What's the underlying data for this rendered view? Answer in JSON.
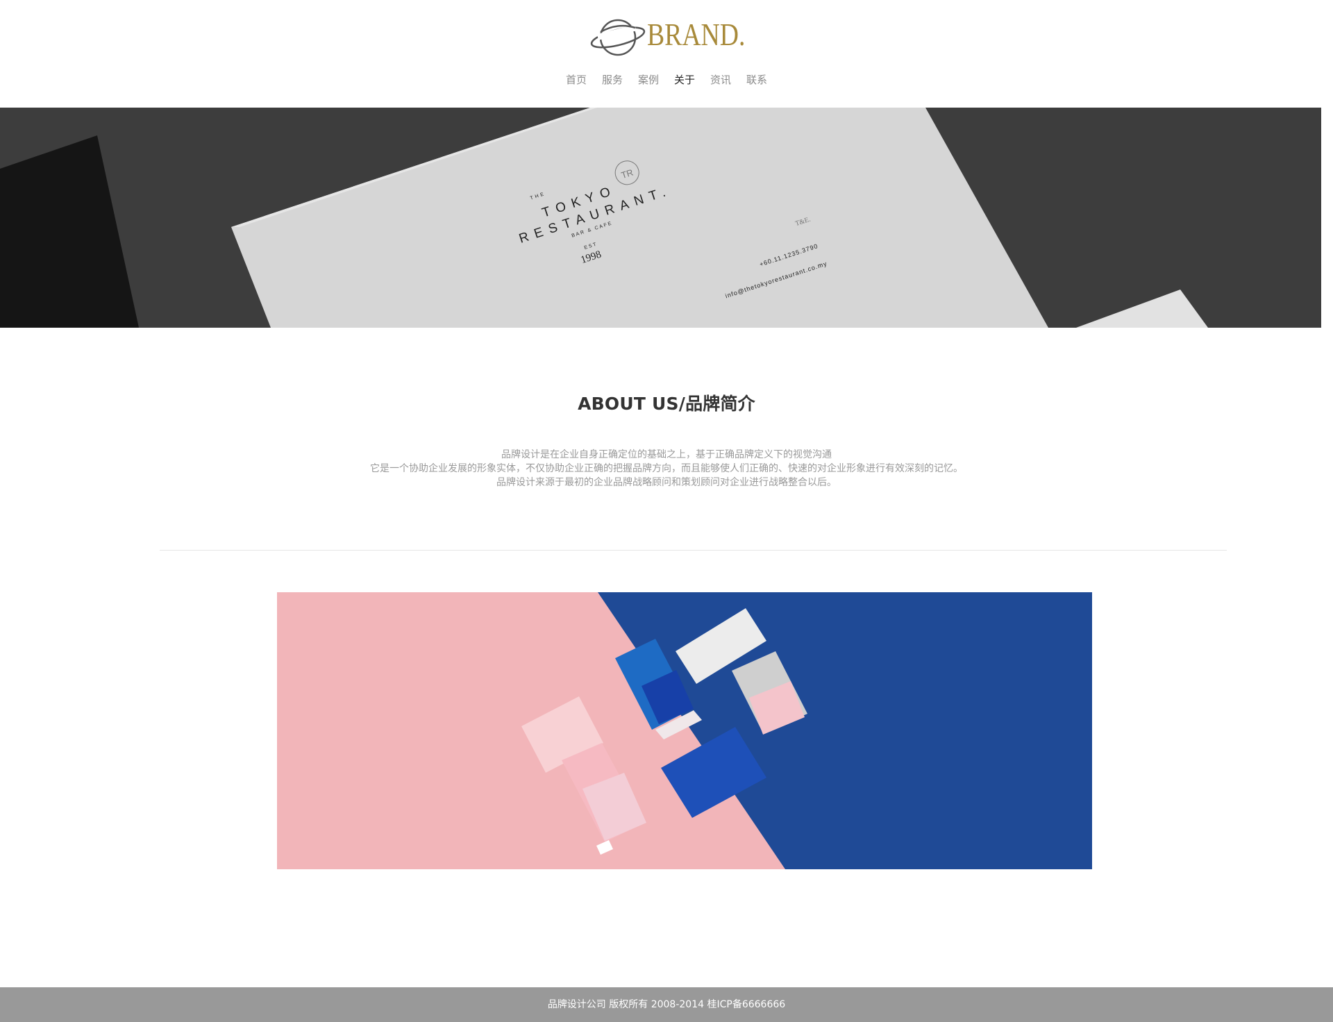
{
  "header": {
    "logo_text": "BRAND.",
    "nav": [
      {
        "label": "首页",
        "active": false
      },
      {
        "label": "服务",
        "active": false
      },
      {
        "label": "案例",
        "active": false
      },
      {
        "label": "关于",
        "active": true
      },
      {
        "label": "资讯",
        "active": false
      },
      {
        "label": "联系",
        "active": false
      }
    ]
  },
  "hero": {
    "card_the": "THE",
    "card_name1": "TOKYO",
    "card_name2": "RESTAURANT.",
    "card_tag": "BAR & CAFE",
    "card_est": "EST",
    "card_year": "1998",
    "card_monogram": "TR",
    "card_initials": "T&E.",
    "card_phone": "+60.11.1235.3790",
    "card_email": "info@thetokyorestaurant.co.my"
  },
  "about": {
    "title": "ABOUT US/品牌简介",
    "lines": [
      "品牌设计是在企业自身正确定位的基础之上，基于正确品牌定义下的视觉沟通",
      "它是一个协助企业发展的形象实体，不仅协助企业正确的把握品牌方向，而且能够使人们正确的、快速的对企业形象进行有效深刻的记忆。",
      "品牌设计来源于最初的企业品牌战略顾问和策划顾问对企业进行战略整合以后。"
    ]
  },
  "footer": {
    "text": "品牌设计公司 版权所有 2008-2014 桂ICP备6666666"
  },
  "colors": {
    "brand_gold": "#a88a3a",
    "pink": "#f2b7bb",
    "blue": "#1f4a96",
    "footer_bg": "#999999"
  }
}
